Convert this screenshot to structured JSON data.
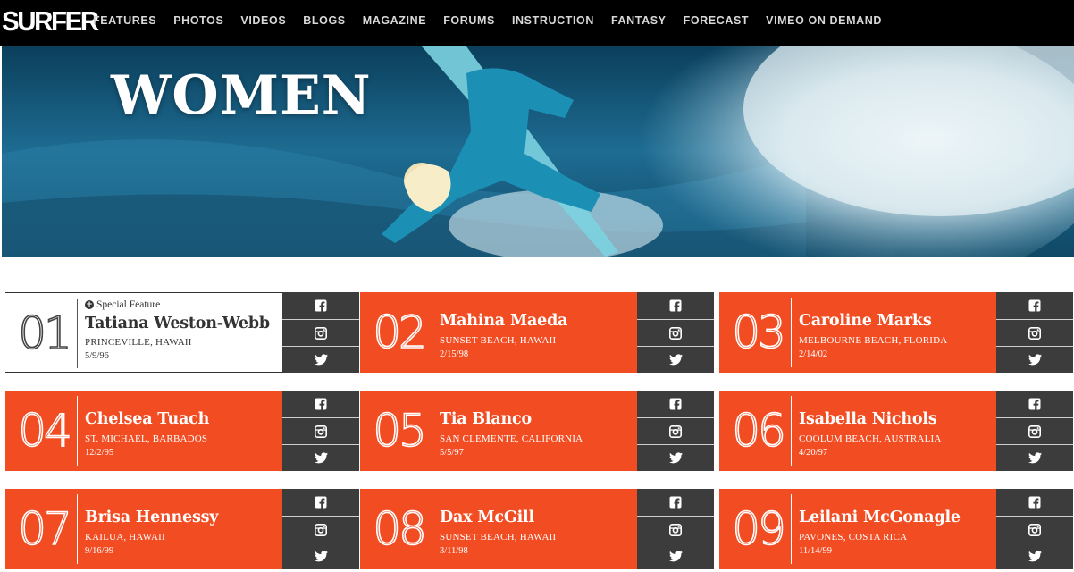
{
  "nav": {
    "logo": "SURFER",
    "items": [
      "FEATURES",
      "PHOTOS",
      "VIDEOS",
      "BLOGS",
      "MAGAZINE",
      "FORUMS",
      "INSTRUCTION",
      "FANTASY",
      "FORECAST",
      "VIMEO ON DEMAND"
    ]
  },
  "hero": {
    "title": "WOMEN"
  },
  "colors": {
    "accent": "#f24c22",
    "social_bg": "#3c3c3c",
    "nav_bg": "#000000"
  },
  "cards": [
    {
      "rank": "01",
      "special": "Special Feature",
      "name": "Tatiana Weston-Webb",
      "location": "PRINCEVILLE, HAWAII",
      "date": "5/9/96"
    },
    {
      "rank": "02",
      "name": "Mahina Maeda",
      "location": "SUNSET BEACH, HAWAII",
      "date": "2/15/98"
    },
    {
      "rank": "03",
      "name": "Caroline Marks",
      "location": "MELBOURNE BEACH, FLORIDA",
      "date": "2/14/02"
    },
    {
      "rank": "04",
      "name": "Chelsea Tuach",
      "location": "ST. MICHAEL, BARBADOS",
      "date": "12/2/95"
    },
    {
      "rank": "05",
      "name": "Tia Blanco",
      "location": "SAN CLEMENTE, CALIFORNIA",
      "date": "5/5/97"
    },
    {
      "rank": "06",
      "name": "Isabella Nichols",
      "location": "COOLUM BEACH, AUSTRALIA",
      "date": "4/20/97"
    },
    {
      "rank": "07",
      "name": "Brisa Hennessy",
      "location": "KAILUA, HAWAII",
      "date": "9/16/99"
    },
    {
      "rank": "08",
      "name": "Dax McGill",
      "location": "SUNSET BEACH, HAWAII",
      "date": "3/11/98"
    },
    {
      "rank": "09",
      "name": "Leilani McGonagle",
      "location": "PAVONES, COSTA RICA",
      "date": "11/14/99"
    }
  ],
  "social_icons": [
    "facebook-icon",
    "instagram-icon",
    "twitter-icon"
  ]
}
